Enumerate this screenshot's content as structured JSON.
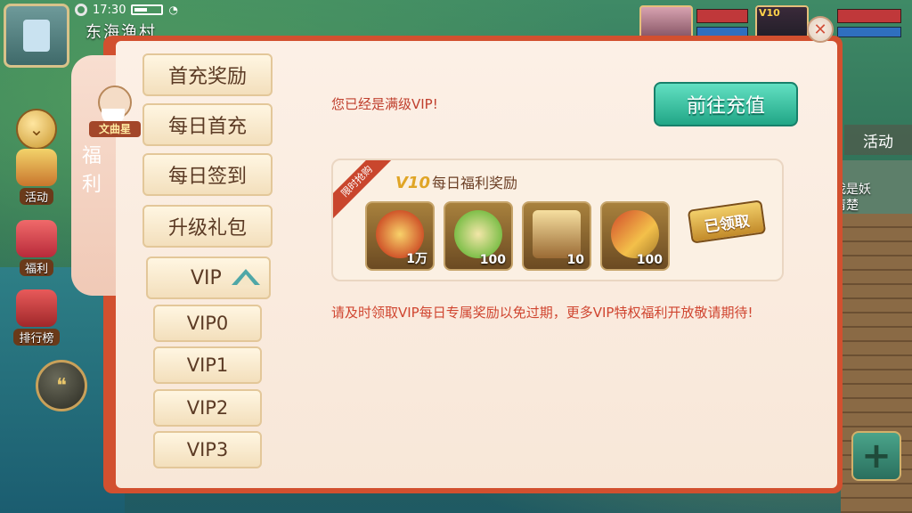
{
  "status_bar": {
    "time": "17:30"
  },
  "location": "东海渔村",
  "sidebar": {
    "items": [
      {
        "label": "活动",
        "icon": "horn-icon"
      },
      {
        "label": "福利",
        "icon": "gift-icon"
      },
      {
        "label": "排行榜",
        "icon": "ranking-icon"
      }
    ]
  },
  "panel": {
    "character_tag": "文曲星",
    "title": "福利",
    "menu": [
      {
        "label": "首充奖励"
      },
      {
        "label": "每日首充"
      },
      {
        "label": "每日签到"
      },
      {
        "label": "升级礼包"
      }
    ],
    "vip_group": {
      "label": "VIP",
      "sub_items": [
        {
          "label": "VIP0"
        },
        {
          "label": "VIP1"
        },
        {
          "label": "VIP2"
        },
        {
          "label": "VIP3"
        }
      ]
    },
    "message_top": "您已经是满级VIP!",
    "recharge_button": "前往充值",
    "reward": {
      "ribbon": "限时抢购",
      "vip_level": "V10",
      "title": "每日福利奖励",
      "items": [
        {
          "name": "coin-icon",
          "qty": "1万"
        },
        {
          "name": "sprout-icon",
          "qty": "100"
        },
        {
          "name": "chest-icon",
          "qty": "10"
        },
        {
          "name": "staff-icon",
          "qty": "100"
        }
      ],
      "claimed_label": "已领取"
    },
    "notice": "请及时领取VIP每日专属奖励以免过期，更多VIP特权福利开放敬请期待!"
  },
  "right_panel": {
    "tab": "活动",
    "text_lines": [
      "我是妖",
      "清楚"
    ]
  },
  "colors": {
    "panel_border": "#d2502f",
    "accent_teal": "#21a686",
    "text_red": "#c0402e",
    "menu_text": "#5b3a24"
  }
}
